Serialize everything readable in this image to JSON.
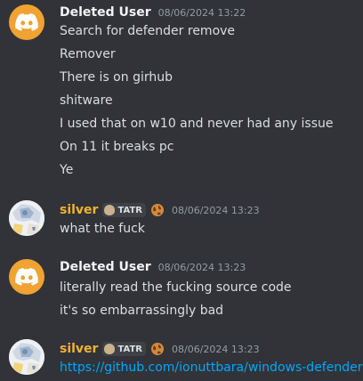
{
  "messages": [
    {
      "author": "Deleted User",
      "timestamp": "08/06/2024 13:22",
      "lines": [
        "Search for defender remove",
        "Remover",
        "There is on girhub",
        "shitware",
        "I used that on w10 and never had any issue",
        "On 11 it breaks pc",
        "Ye"
      ]
    },
    {
      "author": "silver",
      "tag": "TATR",
      "timestamp": "08/06/2024 13:23",
      "lines": [
        "what the fuck"
      ]
    },
    {
      "author": "Deleted User",
      "timestamp": "08/06/2024 13:23",
      "lines": [
        "literally read the fucking source code",
        "it's so embarrassingly bad"
      ]
    },
    {
      "author": "silver",
      "tag": "TATR",
      "timestamp": "08/06/2024 13:23",
      "lines": [
        "https://github.com/ionuttbara/windows-defender"
      ]
    }
  ],
  "colors": {
    "background": "#313338",
    "deleted_avatar": "#f0a232",
    "silver_name": "#f0b232",
    "link": "#00a8fc"
  }
}
